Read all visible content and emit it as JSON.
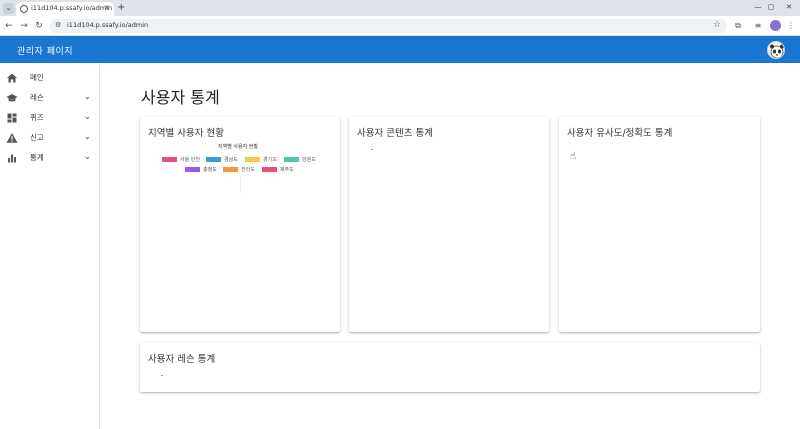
{
  "browser": {
    "tab_title": "i11d104.p.ssafy.io/admin",
    "new_tab_label": "+",
    "url": "i11d104.p.ssafy.io/admin",
    "icons": [
      "tab-list-icon",
      "favicon-icon",
      "close-icon",
      "back-icon",
      "forward-icon",
      "reload-icon",
      "site-info-icon",
      "bookmark-star-icon",
      "extensions-icon",
      "media-icon",
      "profile-icon",
      "menu-icon",
      "minimize-icon",
      "maximize-icon"
    ]
  },
  "app": {
    "title": "관리자 페이지",
    "accent_color": "#1976d2"
  },
  "sidebar": {
    "items": [
      {
        "label": "메인",
        "icon": "home-icon",
        "expandable": false
      },
      {
        "label": "레슨",
        "icon": "school-icon",
        "expandable": true
      },
      {
        "label": "퀴즈",
        "icon": "dashboard-icon",
        "expandable": true
      },
      {
        "label": "신고",
        "icon": "warning-icon",
        "expandable": true
      },
      {
        "label": "통계",
        "icon": "bar-chart-icon",
        "expandable": true
      }
    ]
  },
  "main": {
    "page_title": "사용자 통계",
    "cards": {
      "region": {
        "title": "지역별 사용자 현황"
      },
      "content": {
        "title": "사용자 콘텐츠 통계"
      },
      "accuracy": {
        "title": "사용자 유사도/정확도 통계"
      },
      "lesson": {
        "title": "사용자 레슨 통계"
      }
    }
  },
  "chart_data": {
    "type": "bar",
    "title": "지역별 사용자 현황",
    "categories": [],
    "series": [
      {
        "name": "서울 인천",
        "color": "#e8507a",
        "values": []
      },
      {
        "name": "경상도",
        "color": "#3d9ad9",
        "values": []
      },
      {
        "name": "경기도",
        "color": "#f2c94c",
        "values": []
      },
      {
        "name": "강원도",
        "color": "#4fc3b4",
        "values": []
      },
      {
        "name": "충청도",
        "color": "#9b59e8",
        "values": []
      },
      {
        "name": "전라도",
        "color": "#f29a3d",
        "values": []
      },
      {
        "name": "제주도",
        "color": "#e8507a",
        "values": []
      }
    ],
    "legend_placement": "top"
  }
}
